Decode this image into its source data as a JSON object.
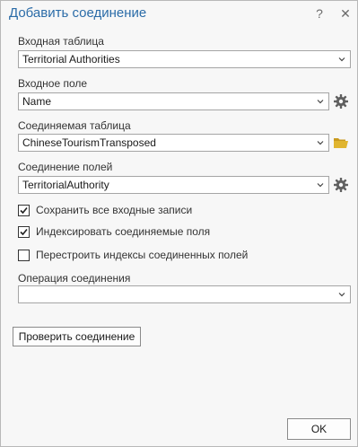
{
  "dialog": {
    "title": "Добавить соединение",
    "help_glyph": "?",
    "close_glyph": "✕"
  },
  "fields": {
    "input_table": {
      "label": "Входная таблица",
      "value": "Territorial Authorities"
    },
    "input_field": {
      "label": "Входное поле",
      "value": "Name"
    },
    "join_table": {
      "label": "Соединяемая таблица",
      "value": "ChineseTourismTransposed"
    },
    "join_field": {
      "label": "Соединение полей",
      "value": "TerritorialAuthority"
    },
    "join_operation": {
      "label": "Операция соединения",
      "value": ""
    }
  },
  "options": {
    "keep_all": {
      "label": "Сохранить все входные записи",
      "checked": true
    },
    "index_join": {
      "label": "Индексировать соединяемые поля",
      "checked": true
    },
    "rebuild_index": {
      "label": "Перестроить индексы соединенных полей",
      "checked": false
    }
  },
  "buttons": {
    "validate": "Проверить соединение",
    "ok": "OK"
  },
  "icons": {
    "gear": "gear-icon",
    "folder": "folder-open-icon",
    "chevron": "chevron-down-icon"
  },
  "colors": {
    "title": "#2b6ca8",
    "folder": "#e0b530",
    "gear": "#606060"
  }
}
